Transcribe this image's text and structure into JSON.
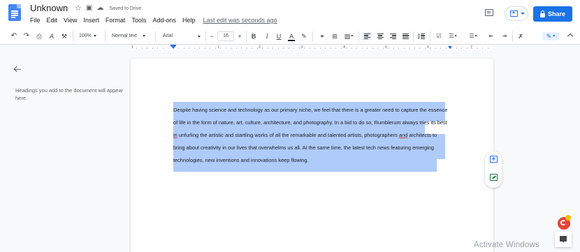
{
  "header": {
    "doc_title": "Unknown",
    "saved_status": "Saved to Drive",
    "menu": [
      "File",
      "Edit",
      "View",
      "Insert",
      "Format",
      "Tools",
      "Add-ons",
      "Help"
    ],
    "last_edit": "Last edit was seconds ago",
    "share_label": "Share"
  },
  "toolbar": {
    "zoom": "100%",
    "style": "Normal text",
    "font": "Arial",
    "font_size": "16"
  },
  "ruler": {
    "numbers": [
      "1",
      "1",
      "2",
      "3",
      "4",
      "5",
      "6",
      "7"
    ]
  },
  "outline": {
    "hint": "Headings you add to the document will appear here."
  },
  "document": {
    "paragraph_parts": [
      "Despite having science and technology as our primary niche, we feel that there is a greater need to capture the essence of life in the form of nature, art, culture, architecture, and photography. In a bid to do so, Rumblerum always tries its best ",
      "in",
      " unfurling the artistic and startling works of all the remarkable and talented artists, photographers ",
      "and",
      " architects to bring about creativity in our lives that overwhelms us all. At the same time, the latest tech news featuring emerging technologies, new inventions and innovations keep flowing."
    ]
  },
  "watermark": "Activate Windows",
  "colors": {
    "accent": "#1a73e8",
    "selection": "#aecbfa",
    "doc_icon": "#4285f4"
  }
}
